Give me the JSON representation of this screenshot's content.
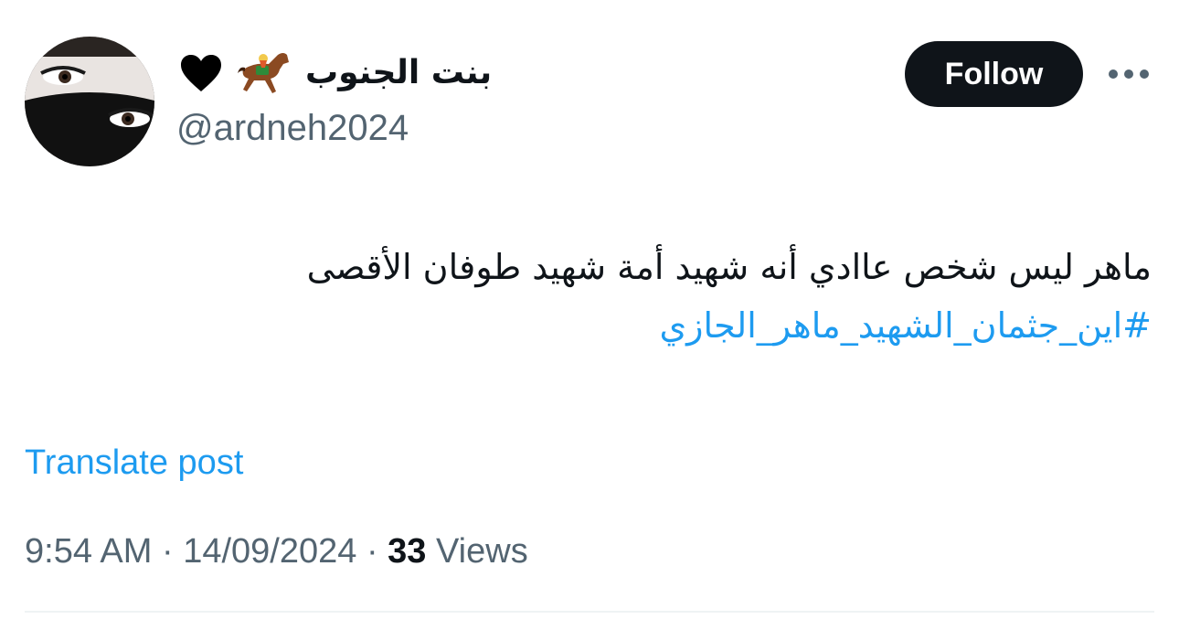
{
  "author": {
    "display_name": "بنت الجنوب",
    "handle": "@ardneh2024",
    "badges": [
      "horse-racing-emoji",
      "black-heart-emoji"
    ]
  },
  "actions": {
    "follow_label": "Follow",
    "more_icon": "ellipsis-icon"
  },
  "post": {
    "text": "ماهر ليس شخص عاادي أنه شهيد أمة شهيد طوفان الأقصى",
    "hashtag": "#اين_جثمان_الشهيد_ماهر_الجازي",
    "translate_label": "Translate post"
  },
  "meta": {
    "time": "9:54 AM",
    "separator": "·",
    "date": "14/09/2024",
    "views_count": "33",
    "views_label": "Views"
  },
  "colors": {
    "text": "#0f1419",
    "secondary": "#536471",
    "link": "#1d9bf0",
    "button_bg": "#0f1419",
    "divider": "#eff3f4"
  }
}
